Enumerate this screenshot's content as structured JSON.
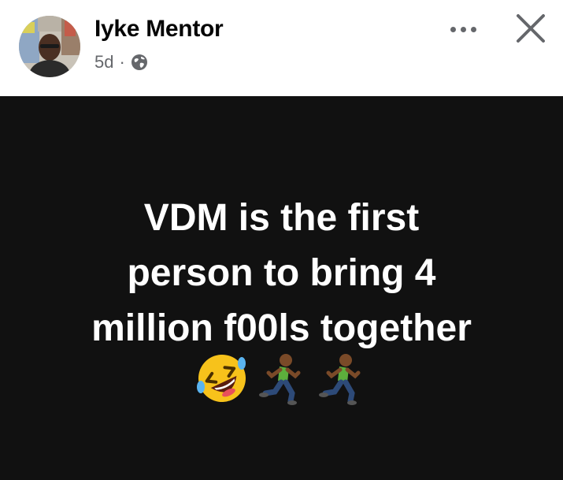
{
  "post": {
    "author_name": "Iyke Mentor",
    "time_ago": "5d",
    "separator": "·",
    "privacy_icon": "globe-icon",
    "text_lines": [
      "VDM is the first",
      "person to bring 4",
      "million f00ls together"
    ],
    "emojis": [
      "rolling-on-floor-laughing-emoji",
      "running-man-emoji",
      "running-man-emoji"
    ]
  },
  "actions": {
    "more_icon": "more-options-icon",
    "close_icon": "close-icon"
  },
  "colors": {
    "header_bg": "#ffffff",
    "media_bg": "#111111",
    "text_primary": "#050505",
    "text_secondary": "#65676b",
    "post_text": "#ffffff"
  }
}
